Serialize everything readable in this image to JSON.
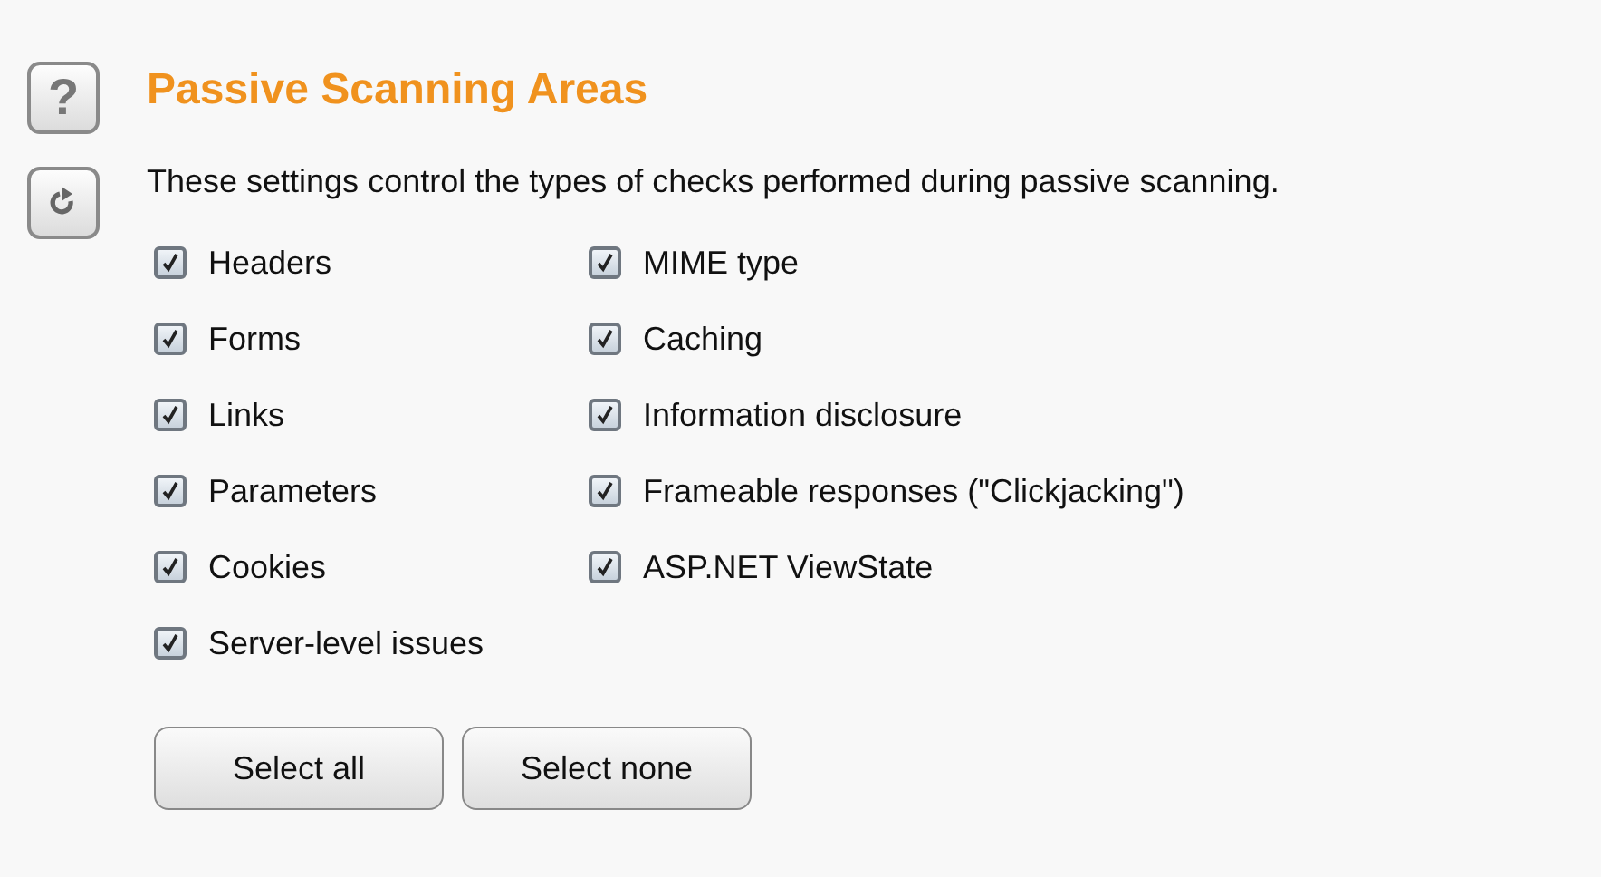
{
  "title": "Passive Scanning Areas",
  "description": "These settings control the types of checks performed during passive scanning.",
  "help_button": "?",
  "columns": [
    {
      "items": [
        {
          "label": "Headers",
          "checked": true
        },
        {
          "label": "Forms",
          "checked": true
        },
        {
          "label": "Links",
          "checked": true
        },
        {
          "label": "Parameters",
          "checked": true
        },
        {
          "label": "Cookies",
          "checked": true
        },
        {
          "label": "Server-level issues",
          "checked": true
        }
      ]
    },
    {
      "items": [
        {
          "label": "MIME type",
          "checked": true
        },
        {
          "label": "Caching",
          "checked": true
        },
        {
          "label": "Information disclosure",
          "checked": true
        },
        {
          "label": "Frameable responses (\"Clickjacking\")",
          "checked": true
        },
        {
          "label": "ASP.NET ViewState",
          "checked": true
        }
      ]
    }
  ],
  "buttons": [
    "Select all",
    "Select none"
  ]
}
